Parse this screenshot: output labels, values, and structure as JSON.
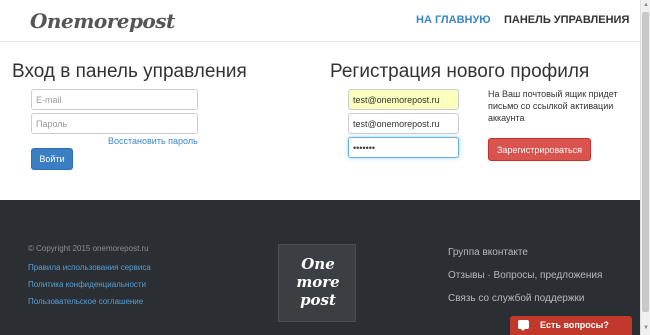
{
  "header": {
    "logo": "Onemorepost",
    "nav": {
      "home": "НА ГЛАВНУЮ",
      "panel": "ПАНЕЛЬ УПРАВЛЕНИЯ"
    }
  },
  "login": {
    "title": "Вход в панель управления",
    "email_placeholder": "E-mail",
    "password_placeholder": "Пароль",
    "forgot_link": "Восстановить пароль",
    "submit_label": "Войти"
  },
  "register": {
    "title": "Регистрация нового профиля",
    "email_value": "test@onemorepost.ru",
    "email_confirm_value": "test@onemorepost.ru",
    "password_value": "1234567",
    "note": "На Ваш почтовый ящик придет письмо со ссылкой активации аккаунта",
    "submit_label": "Зарегистрироваться"
  },
  "footer": {
    "copyright": "© Copyright 2015 onemorepost.ru",
    "links_left": [
      "Правила использования сервиса",
      "Политика конфиденциальности",
      "Пользовательское соглашение"
    ],
    "logo_lines": [
      "One",
      "more",
      "post"
    ],
    "links_right": [
      "Группа вконтакте",
      "Отзывы · Вопросы, предложения",
      "Связь со службой поддержки"
    ]
  },
  "chat": {
    "label": "Есть вопросы?"
  }
}
